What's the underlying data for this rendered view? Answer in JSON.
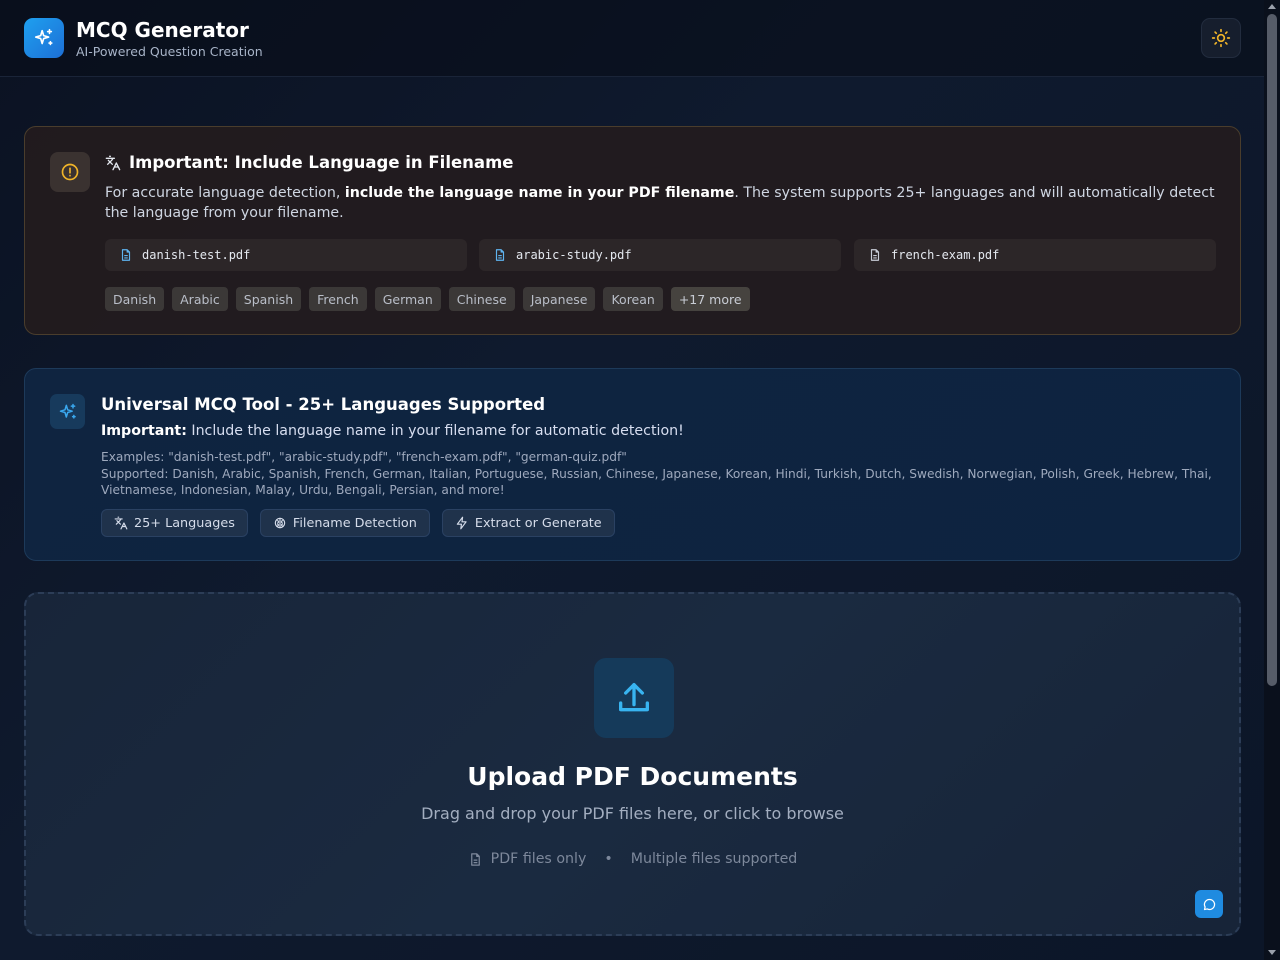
{
  "header": {
    "title": "MCQ Generator",
    "subtitle": "AI-Powered Question Creation"
  },
  "warning": {
    "title": "Important: Include Language in Filename",
    "desc_prefix": "For accurate language detection, ",
    "desc_bold": "include the language name in your PDF filename",
    "desc_suffix": ". The system supports 25+ languages and will automatically detect the language from your filename.",
    "examples": [
      "danish-test.pdf",
      "arabic-study.pdf",
      "french-exam.pdf"
    ],
    "languages": [
      "Danish",
      "Arabic",
      "Spanish",
      "French",
      "German",
      "Chinese",
      "Japanese",
      "Korean"
    ],
    "more": "+17 more"
  },
  "info": {
    "title": "Universal MCQ Tool - 25+ Languages Supported",
    "important_label": "Important:",
    "important_text": " Include the language name in your filename for automatic detection!",
    "examples": "Examples: \"danish-test.pdf\", \"arabic-study.pdf\", \"french-exam.pdf\", \"german-quiz.pdf\"",
    "supported": "Supported: Danish, Arabic, Spanish, French, German, Italian, Portuguese, Russian, Chinese, Japanese, Korean, Hindi, Turkish, Dutch, Swedish, Norwegian, Polish, Greek, Hebrew, Thai, Vietnamese, Indonesian, Malay, Urdu, Bengali, Persian, and more!",
    "badges": [
      "25+ Languages",
      "Filename Detection",
      "Extract or Generate"
    ]
  },
  "upload": {
    "title": "Upload PDF Documents",
    "subtitle": "Drag and drop your PDF files here, or click to browse",
    "meta_1": "PDF files only",
    "separator": "•",
    "meta_2": "Multiple files supported"
  },
  "colors": {
    "accent": "#1ea0ef",
    "warning": "#f0b429"
  }
}
